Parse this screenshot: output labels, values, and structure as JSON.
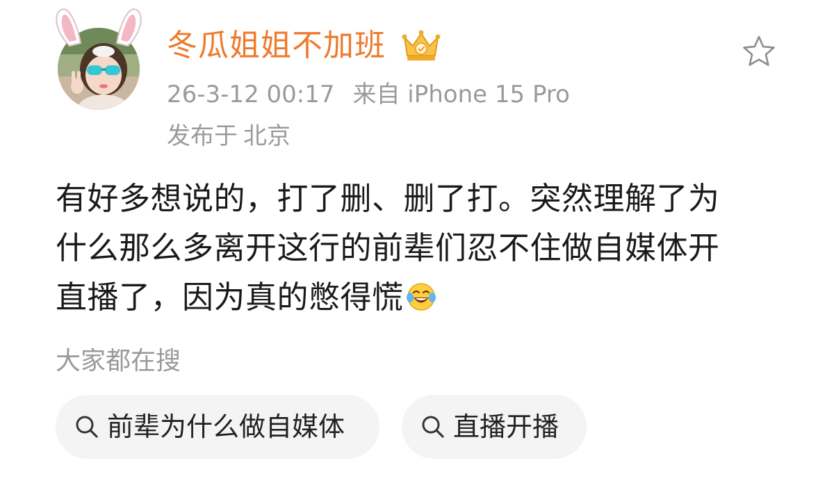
{
  "post": {
    "author": {
      "name": "冬瓜姐姐不加班",
      "name_color": "#ee7a2c",
      "badge_icon": "crown-badge-icon",
      "avatar_icon": "avatar-girl-bunny-ears"
    },
    "meta": {
      "timestamp": "26-3-12 00:17",
      "source": "来自 iPhone 15 Pro",
      "location_prefix": "发布于",
      "location": "北京"
    },
    "actions": {
      "favorite_icon": "star-outline-icon"
    },
    "content": {
      "lines": [
        "有好多想说的，打了删、删了打。突然理解了为",
        "什么那么多离开这行的前辈们忍不住做自媒体开",
        "直播了，因为真的憋得慌"
      ],
      "trailing_emoji": "laugh-cry-emoji"
    }
  },
  "search": {
    "title": "大家都在搜",
    "chips": [
      {
        "label": "前辈为什么做自媒体",
        "icon": "search-icon"
      },
      {
        "label": "直播开播",
        "icon": "search-icon"
      }
    ]
  }
}
